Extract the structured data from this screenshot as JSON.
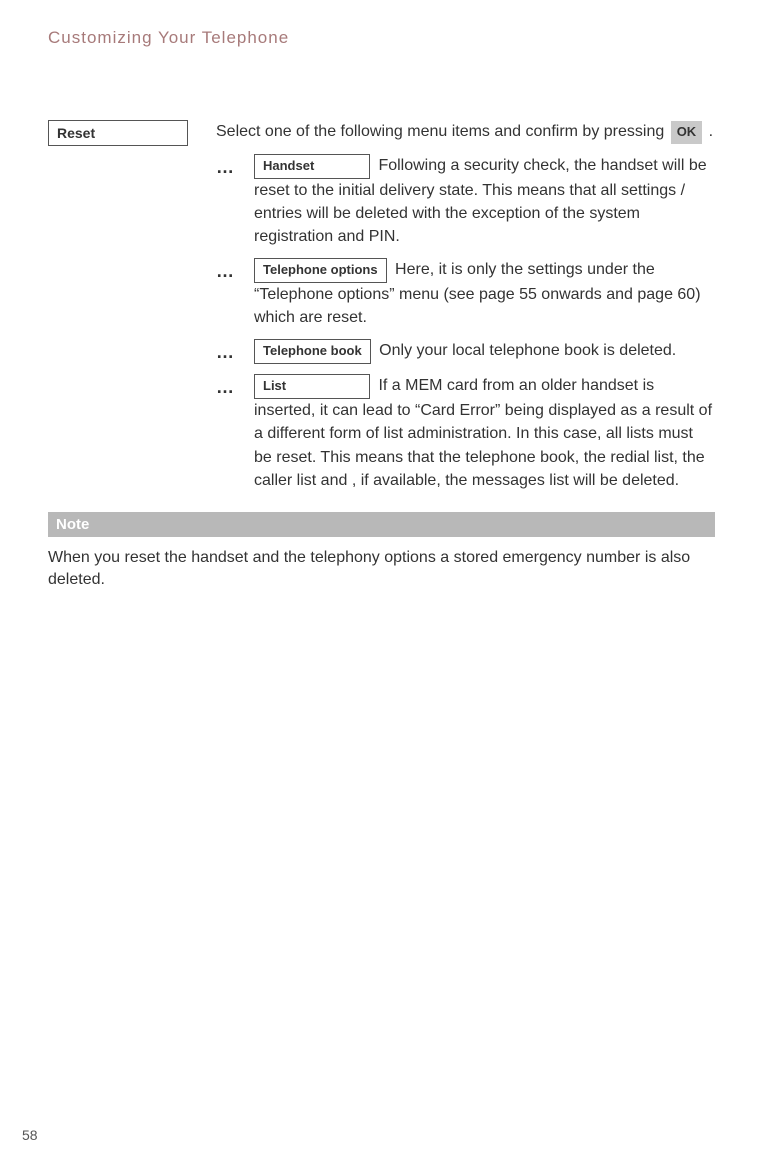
{
  "header_title": "Customizing Your Telephone",
  "sidebar_box": "Reset",
  "intro_text_1": "Select one of the following menu items and confirm by pressing ",
  "ok_label": "OK",
  "intro_text_2": " .",
  "items": [
    {
      "label": "Handset",
      "desc": " Following a security check, the handset will be reset to the initial delivery state. This means that all settings / entries will be deleted with the exception of the system registration and PIN."
    },
    {
      "label": "Telephone options",
      "desc": " Here, it is only the settings under the “Telephone options” menu (see page 55 onwards and page 60) which are reset."
    },
    {
      "label": "Telephone book",
      "desc": " Only your local telephone book is deleted."
    },
    {
      "label": "List",
      "desc": " If a MEM card from an older handset is inserted, it can lead to “Card Error” being displayed as a result of a different form of list administration. In this case, all lists must be reset. This means that the telephone book, the redial list, the caller list and , if available, the messages list will be deleted."
    }
  ],
  "note_label": "Note",
  "note_body": "When you reset the handset and the telephony options a stored emergency number is also deleted.",
  "page_number": "58",
  "ellipsis": "…"
}
